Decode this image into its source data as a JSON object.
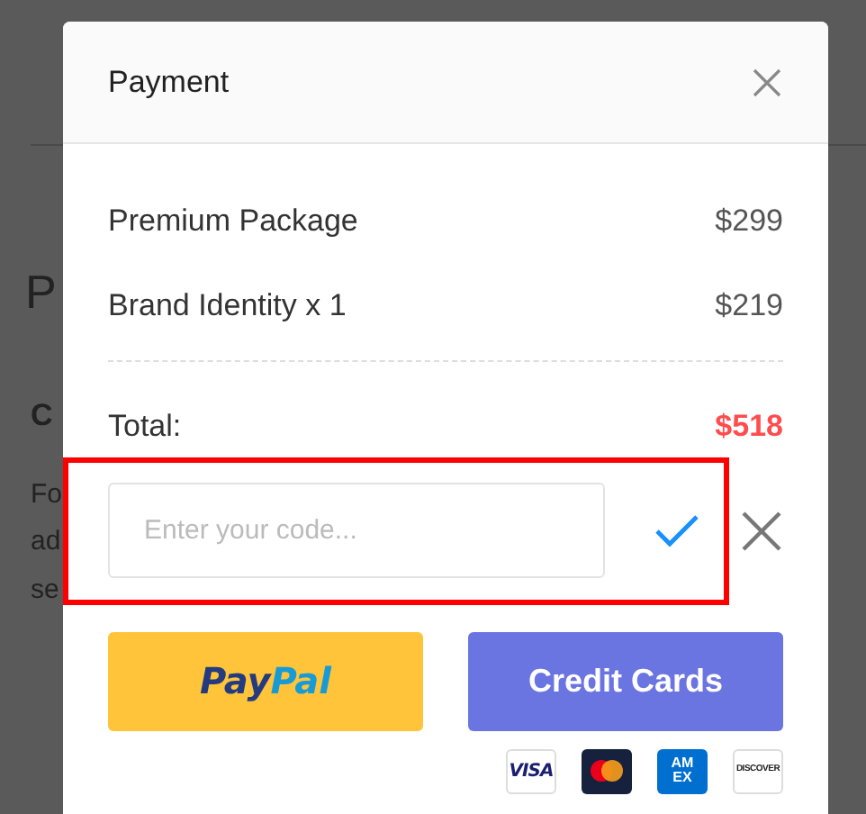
{
  "background": {
    "heading": "P",
    "subheading": "C",
    "lines": [
      "Fo",
      "ad",
      "se"
    ]
  },
  "modal": {
    "title": "Payment",
    "items": [
      {
        "name": "Premium Package",
        "price": "$299"
      },
      {
        "name": "Brand Identity x 1",
        "price": "$219"
      }
    ],
    "total_label": "Total:",
    "total": "$518",
    "coupon": {
      "placeholder": "Enter your code...",
      "highlighted": true
    },
    "buttons": [
      {
        "kind": "paypal",
        "parts": [
          "Pay",
          "Pal"
        ]
      },
      {
        "kind": "cards",
        "label": "Credit Cards"
      }
    ],
    "cards": [
      {
        "kind": "visa",
        "text": "VISA"
      },
      {
        "kind": "mastercard"
      },
      {
        "kind": "amex",
        "text": "AM EX"
      },
      {
        "kind": "discover",
        "text": "DISCOVER"
      }
    ]
  }
}
